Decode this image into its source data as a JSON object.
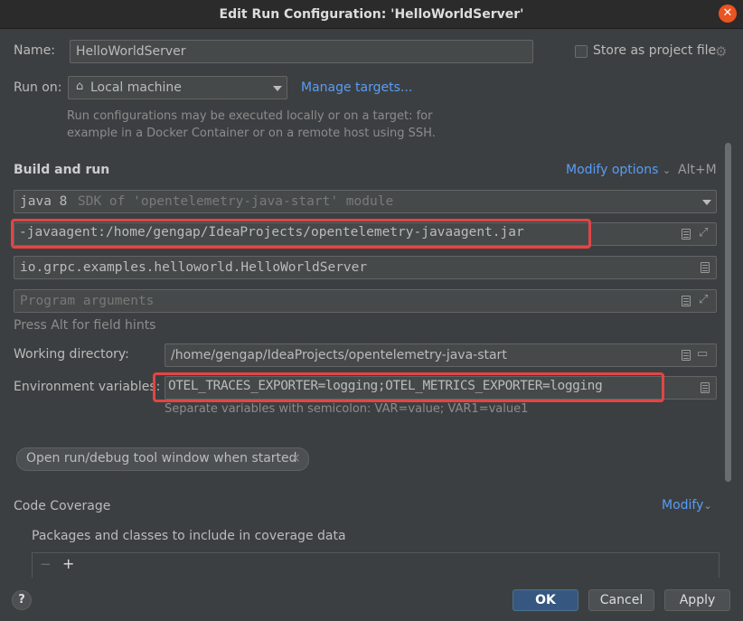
{
  "window": {
    "title": "Edit Run Configuration: 'HelloWorldServer'"
  },
  "name_row": {
    "label": "Name:",
    "value": "HelloWorldServer",
    "store_label": "Store as project file"
  },
  "run_on": {
    "label": "Run on:",
    "value": "Local machine",
    "manage_link": "Manage targets...",
    "description_line1": "Run configurations may be executed locally or on a target: for",
    "description_line2": "example in a Docker Container or on a remote host using SSH."
  },
  "build_and_run": {
    "heading": "Build and run",
    "modify_options": "Modify options",
    "shortcut": "Alt+M",
    "jre_primary": "java 8",
    "jre_secondary": "SDK of 'opentelemetry-java-start' module",
    "vm_options": "-javaagent:/home/gengap/IdeaProjects/opentelemetry-javaagent.jar",
    "main_class": "io.grpc.examples.helloworld.HelloWorldServer",
    "program_args_placeholder": "Program arguments",
    "field_hint": "Press Alt for field hints"
  },
  "working_dir": {
    "label": "Working directory:",
    "value": "/home/gengap/IdeaProjects/opentelemetry-java-start"
  },
  "env_vars": {
    "label": "Environment variables:",
    "value": "OTEL_TRACES_EXPORTER=logging;OTEL_METRICS_EXPORTER=logging",
    "hint": "Separate variables with semicolon: VAR=value; VAR1=value1"
  },
  "chip": {
    "label": "Open run/debug tool window when started",
    "close": "×"
  },
  "coverage": {
    "heading": "Code Coverage",
    "modify": "Modify",
    "packages_label": "Packages and classes to include in coverage data",
    "remove": "−",
    "add": "+"
  },
  "footer": {
    "help": "?",
    "ok": "OK",
    "cancel": "Cancel",
    "apply": "Apply"
  },
  "icons": {
    "close": "close-icon",
    "home": "home-icon",
    "gear": "gear-icon"
  }
}
